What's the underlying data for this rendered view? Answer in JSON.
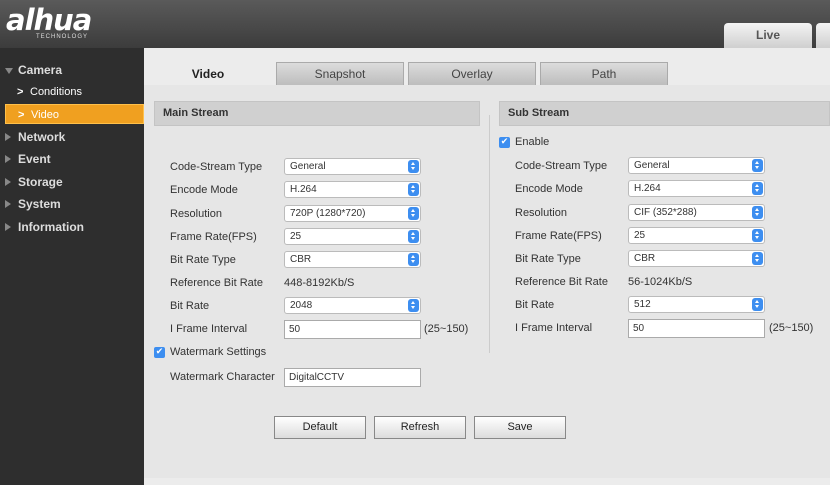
{
  "brand": {
    "logo": "alhua",
    "sub": "TECHNOLOGY"
  },
  "header": {
    "live_tab": "Live"
  },
  "sidebar": {
    "camera": "Camera",
    "conditions": "Conditions",
    "video": "Video",
    "network": "Network",
    "event": "Event",
    "storage": "Storage",
    "system": "System",
    "information": "Information"
  },
  "tabs": {
    "video": "Video",
    "snapshot": "Snapshot",
    "overlay": "Overlay",
    "path": "Path"
  },
  "main_stream": {
    "title": "Main Stream",
    "code_stream_type_label": "Code-Stream Type",
    "code_stream_type": "General",
    "encode_mode_label": "Encode Mode",
    "encode_mode": "H.264",
    "resolution_label": "Resolution",
    "resolution": "720P (1280*720)",
    "frame_rate_label": "Frame Rate(FPS)",
    "frame_rate": "25",
    "bit_rate_type_label": "Bit Rate Type",
    "bit_rate_type": "CBR",
    "reference_bit_rate_label": "Reference Bit Rate",
    "reference_bit_rate": "448-8192Kb/S",
    "bit_rate_label": "Bit Rate",
    "bit_rate": "2048",
    "iframe_label": "I Frame Interval",
    "iframe": "50",
    "iframe_range": "(25~150)",
    "watermark_settings_label": "Watermark Settings",
    "watermark_settings_checked": true,
    "watermark_character_label": "Watermark Character",
    "watermark_character": "DigitalCCTV"
  },
  "sub_stream": {
    "title": "Sub Stream",
    "enable_label": "Enable",
    "enable_checked": true,
    "code_stream_type_label": "Code-Stream Type",
    "code_stream_type": "General",
    "encode_mode_label": "Encode Mode",
    "encode_mode": "H.264",
    "resolution_label": "Resolution",
    "resolution": "CIF (352*288)",
    "frame_rate_label": "Frame Rate(FPS)",
    "frame_rate": "25",
    "bit_rate_type_label": "Bit Rate Type",
    "bit_rate_type": "CBR",
    "reference_bit_rate_label": "Reference Bit Rate",
    "reference_bit_rate": "56-1024Kb/S",
    "bit_rate_label": "Bit Rate",
    "bit_rate": "512",
    "iframe_label": "I Frame Interval",
    "iframe": "50",
    "iframe_range": "(25~150)"
  },
  "buttons": {
    "default": "Default",
    "refresh": "Refresh",
    "save": "Save"
  },
  "colors": {
    "accent": "#f0a020",
    "select_spinner": "#3d8ef0"
  },
  "icons": {
    "check": "✔",
    "chevron": ">"
  }
}
